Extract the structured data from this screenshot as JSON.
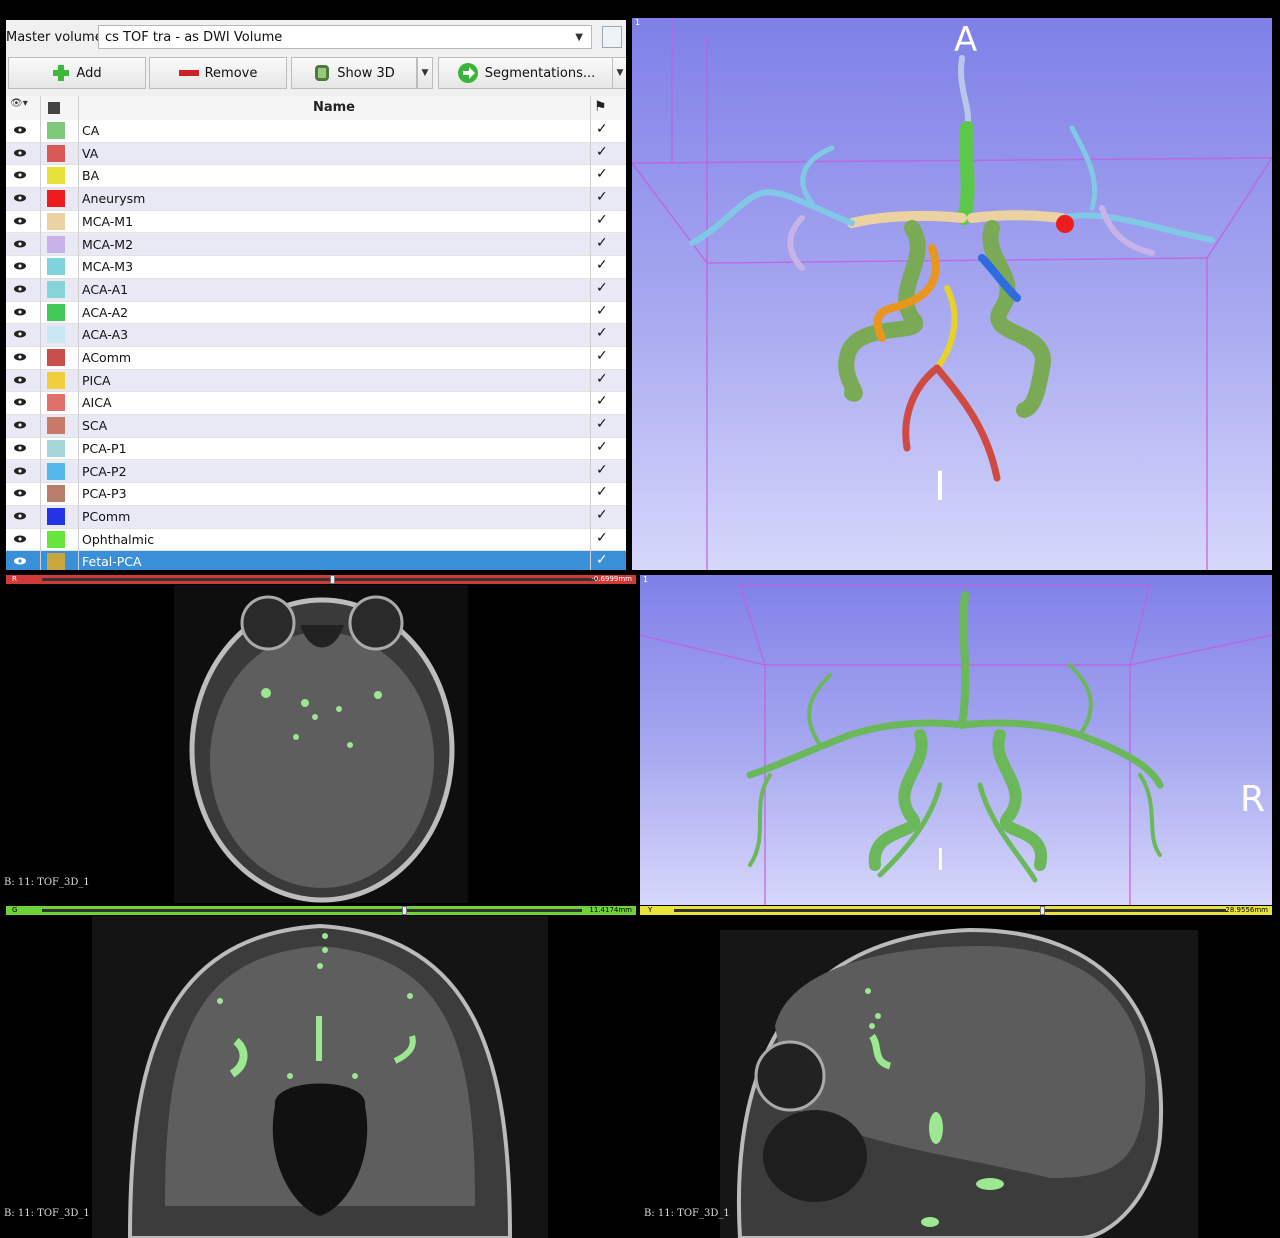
{
  "segment_editor": {
    "master_volume_label": "Master volume:",
    "master_volume_value": "cs TOF tra - as DWI Volume",
    "toolbar": {
      "add_label": "Add",
      "remove_label": "Remove",
      "show3d_label": "Show 3D",
      "segmentations_label": "Segmentations..."
    },
    "table": {
      "name_header": "Name",
      "rows": [
        {
          "name": "CA",
          "color": "#7ec97a"
        },
        {
          "name": "VA",
          "color": "#d85a57"
        },
        {
          "name": "BA",
          "color": "#e6e23a"
        },
        {
          "name": "Aneurysm",
          "color": "#ee1d1d"
        },
        {
          "name": "MCA-M1",
          "color": "#ecd2a0"
        },
        {
          "name": "MCA-M2",
          "color": "#c7b2ea"
        },
        {
          "name": "MCA-M3",
          "color": "#7fd3dc"
        },
        {
          "name": "ACA-A1",
          "color": "#84d4d8"
        },
        {
          "name": "ACA-A2",
          "color": "#43c85a"
        },
        {
          "name": "ACA-A3",
          "color": "#c9e8f4"
        },
        {
          "name": "AComm",
          "color": "#c9504a"
        },
        {
          "name": "PICA",
          "color": "#f0cf3a"
        },
        {
          "name": "AICA",
          "color": "#e2706a"
        },
        {
          "name": "SCA",
          "color": "#c87a6a"
        },
        {
          "name": "PCA-P1",
          "color": "#a4d7dc"
        },
        {
          "name": "PCA-P2",
          "color": "#55b8ea"
        },
        {
          "name": "PCA-P3",
          "color": "#b97e6c"
        },
        {
          "name": "PComm",
          "color": "#2334e6"
        },
        {
          "name": "Ophthalmic",
          "color": "#66e63a"
        },
        {
          "name": "Fetal-PCA",
          "color": "#c8a83c",
          "selected": true
        }
      ]
    }
  },
  "views": {
    "view3d_top": {
      "id": "1",
      "orient_top": "A",
      "orient_bottom": "I"
    },
    "view3d_bottom": {
      "id": "1",
      "orient_right": "R",
      "orient_left": "",
      "orient_bottom": "I"
    },
    "red_slice": {
      "label": "R",
      "offset": "-0.6999mm",
      "caption": "B: 11: TOF_3D_1"
    },
    "green_slice": {
      "label": "G",
      "offset": "11.4174mm",
      "caption": "B: 11: TOF_3D_1"
    },
    "yellow_slice": {
      "label": "Y",
      "offset": "28.9556mm",
      "caption": "B: 11: TOF_3D_1"
    }
  },
  "colors": {
    "red_bar": "#d23a3a",
    "green_bar": "#6fd23a",
    "yellow_bar": "#e8e23a",
    "selection": "#3a8fd9"
  }
}
